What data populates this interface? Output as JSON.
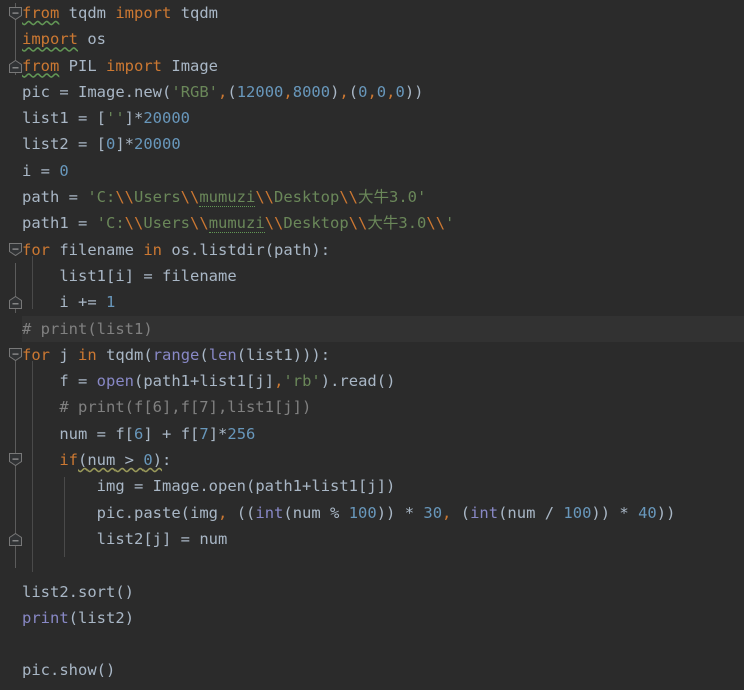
{
  "editor": {
    "language": "Python",
    "theme": "Darcula",
    "background_color": "#2b2b2b",
    "caret_line_color": "#323232",
    "default_text_color": "#a9b7c6",
    "keyword_color": "#cc7832",
    "string_color": "#6a8759",
    "number_color": "#6897bb",
    "builtin_color": "#8888c6",
    "comment_color": "#808080",
    "indent_guide_color": "#4a4a4a",
    "fold_gutter_color": "#5c5c5c",
    "caret_line_number": 13
  },
  "code_lines": [
    {
      "n": 1,
      "text": "from tqdm import tqdm"
    },
    {
      "n": 2,
      "text": "import os"
    },
    {
      "n": 3,
      "text": "from PIL import Image"
    },
    {
      "n": 4,
      "text": "pic = Image.new('RGB',(12000,8000),(0,0,0))"
    },
    {
      "n": 5,
      "text": "list1 = ['']*20000"
    },
    {
      "n": 6,
      "text": "list2 = [0]*20000"
    },
    {
      "n": 7,
      "text": "i = 0"
    },
    {
      "n": 8,
      "text": "path = 'C:\\\\Users\\\\mumuzi\\\\Desktop\\\\大牛3.0'"
    },
    {
      "n": 9,
      "text": "path1 = 'C:\\\\Users\\\\mumuzi\\\\Desktop\\\\大牛3.0\\\\'"
    },
    {
      "n": 10,
      "text": "for filename in os.listdir(path):"
    },
    {
      "n": 11,
      "text": "    list1[i] = filename"
    },
    {
      "n": 12,
      "text": "    i += 1"
    },
    {
      "n": 13,
      "text": "# print(list1)"
    },
    {
      "n": 14,
      "text": "for j in tqdm(range(len(list1))):"
    },
    {
      "n": 15,
      "text": "    f = open(path1+list1[j],'rb').read()"
    },
    {
      "n": 16,
      "text": "    # print(f[6],f[7],list1[j])"
    },
    {
      "n": 17,
      "text": "    num = f[6] + f[7]*256"
    },
    {
      "n": 18,
      "text": "    if(num > 0):"
    },
    {
      "n": 19,
      "text": "        img = Image.open(path1+list1[j])"
    },
    {
      "n": 20,
      "text": "        pic.paste(img, ((int(num % 100)) * 30, (int(num / 100)) * 40))"
    },
    {
      "n": 21,
      "text": "        list2[j] = num"
    },
    {
      "n": 22,
      "text": ""
    },
    {
      "n": 23,
      "text": "list2.sort()"
    },
    {
      "n": 24,
      "text": "print(list2)"
    },
    {
      "n": 25,
      "text": ""
    },
    {
      "n": 26,
      "text": "pic.show()"
    }
  ],
  "tokens": {
    "kw_from": "from",
    "kw_import": "import",
    "kw_for": "for",
    "kw_in": "in",
    "kw_if": "if",
    "mod_tqdm": "tqdm",
    "mod_os": "os",
    "mod_PIL": "PIL",
    "cls_Image": "Image",
    "var_pic": "pic",
    "var_list1": "list1",
    "var_list2": "list2",
    "var_i": "i",
    "var_j": "j",
    "var_f": "f",
    "var_num": "num",
    "var_img": "img",
    "var_path": "path",
    "var_path1": "path1",
    "var_filename": "filename",
    "m_new": "new",
    "m_listdir": "listdir",
    "m_read": "read",
    "m_paste": "paste",
    "m_sort": "sort",
    "m_show": "show",
    "m_open": "open",
    "bi_range": "range",
    "bi_len": "len",
    "bi_open": "open",
    "bi_int": "int",
    "bi_print": "print",
    "str_rgb": "'RGB'",
    "str_empty": "''",
    "str_rb": "'rb'",
    "num_12000": "12000",
    "num_8000": "8000",
    "num_0": "0",
    "num_20000": "20000",
    "num_1": "1",
    "num_6": "6",
    "num_7": "7",
    "num_256": "256",
    "num_100": "100",
    "num_30": "30",
    "num_40": "40",
    "comment_1": "# print(list1)",
    "comment_2": "# print(f[6],f[7],list1[j])",
    "path_prefix": "'C:",
    "path_users": "Users",
    "path_user": "mumuzi",
    "path_desktop": "Desktop",
    "path_folder": "大牛3.0",
    "esc": "\\\\"
  },
  "fold_markers": [
    {
      "name": "fold-start-imports",
      "line": 1,
      "state": "expanded",
      "shape": "down-pentagon"
    },
    {
      "name": "fold-end-imports",
      "line": 3,
      "state": "expanded",
      "shape": "up-pentagon"
    },
    {
      "name": "fold-start-for-1",
      "line": 10,
      "state": "expanded",
      "shape": "down-pentagon"
    },
    {
      "name": "fold-end-for-1",
      "line": 12,
      "state": "expanded",
      "shape": "up-pentagon"
    },
    {
      "name": "fold-start-for-2",
      "line": 14,
      "state": "expanded",
      "shape": "down-pentagon"
    },
    {
      "name": "fold-start-if",
      "line": 18,
      "state": "expanded",
      "shape": "down-pentagon"
    },
    {
      "name": "fold-end-if",
      "line": 21,
      "state": "expanded",
      "shape": "up-pentagon"
    }
  ],
  "inspections": [
    {
      "target": "from",
      "line": 1,
      "type": "weak-warning",
      "style": "wavy",
      "color": "#629755"
    },
    {
      "target": "import",
      "line": 2,
      "type": "weak-warning",
      "style": "wavy",
      "color": "#629755"
    },
    {
      "target": "from",
      "line": 3,
      "type": "weak-warning",
      "style": "wavy",
      "color": "#629755"
    },
    {
      "target": "mumuzi",
      "line": 8,
      "type": "typo",
      "style": "dotted",
      "color": "#629755"
    },
    {
      "target": "mumuzi",
      "line": 9,
      "type": "typo",
      "style": "dotted",
      "color": "#629755"
    },
    {
      "target": "(num > 0)",
      "line": 18,
      "type": "weak-warning",
      "style": "wavy",
      "color": "#9a9a5a"
    }
  ]
}
